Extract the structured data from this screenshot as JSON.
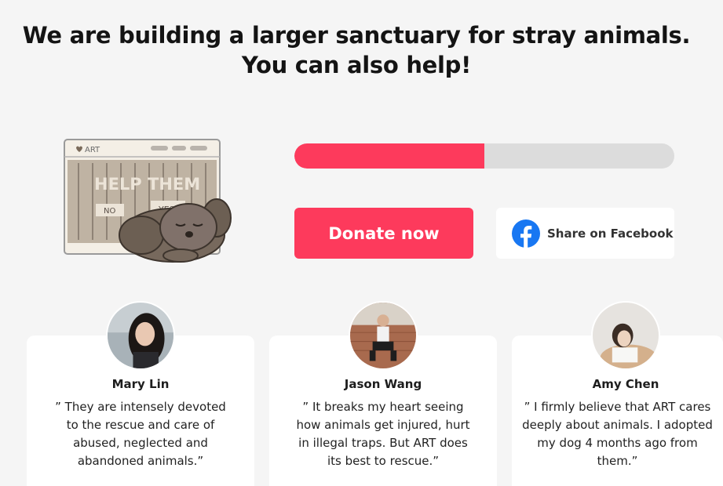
{
  "headline": {
    "line1": "We are building a larger sanctuary for stray animals.",
    "line2": "You can also help!"
  },
  "illustration": {
    "window_title": "ART",
    "sign_text": "HELP THEM",
    "no_label": "NO",
    "yes_label": "YES"
  },
  "progress": {
    "fraction": 0.5
  },
  "actions": {
    "donate_label": "Donate now",
    "share_label": "Share on Facebook"
  },
  "testimonials": [
    {
      "name": "Mary Lin",
      "quote": "” They are intensely devoted to the rescue and care of abused, neglected and abandoned animals.”"
    },
    {
      "name": "Jason Wang",
      "quote": "” It breaks my heart seeing how animals get injured, hurt in illegal traps. But ART does its best to rescue.”"
    },
    {
      "name": "Amy Chen",
      "quote": "” I firmly believe that ART cares deeply about animals. I adopted my dog 4 months ago from them.”"
    }
  ],
  "colors": {
    "accent": "#fd3a5c",
    "facebook": "#1877f2",
    "track": "#dcdcdc"
  },
  "icons": {
    "share": "facebook-icon",
    "window": "heart-icon"
  }
}
